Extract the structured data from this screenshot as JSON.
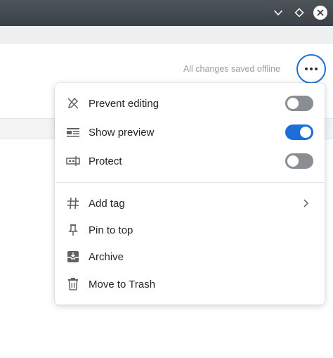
{
  "window": {
    "controls": [
      "chevron-down-icon",
      "diamond-icon",
      "close-icon"
    ]
  },
  "note": {
    "status_text": "All changes saved offline",
    "more_button_icon": "more-horizontal-icon"
  },
  "menu": {
    "toggles": [
      {
        "label": "Prevent editing",
        "icon": "pencil-off-icon",
        "enabled": false
      },
      {
        "label": "Show preview",
        "icon": "preview-icon",
        "enabled": true
      },
      {
        "label": "Protect",
        "icon": "protect-icon",
        "enabled": false
      }
    ],
    "actions": [
      {
        "label": "Add tag",
        "icon": "hash-icon",
        "has_submenu": true
      },
      {
        "label": "Pin to top",
        "icon": "pin-icon",
        "has_submenu": false
      },
      {
        "label": "Archive",
        "icon": "archive-icon",
        "has_submenu": false
      },
      {
        "label": "Move to Trash",
        "icon": "trash-icon",
        "has_submenu": false
      }
    ]
  },
  "colors": {
    "accent": "#1d6fd8",
    "toggle_off": "#8a8e93",
    "titlebar": "#43494e"
  }
}
